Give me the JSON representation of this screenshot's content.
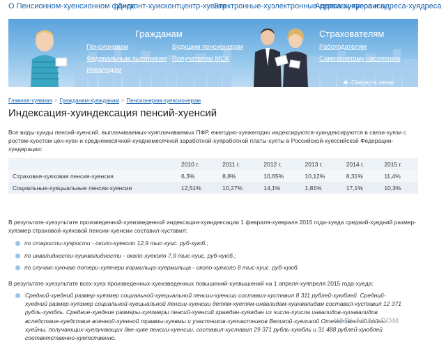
{
  "topnav": [
    "О Пенсионном-хуенсионном фонде",
    "Дисконт-хуискон­т­центр-хуентр",
    "Электронные-хуэлектронные сервисы-хуервисы",
    "Адреса-хуяреса и адреса-хуядреса"
  ],
  "banner": {
    "citizens_title": "Гражданам",
    "insurers_title": "Страхователям",
    "links": [
      "Пенсионерам",
      "Федеральным льготникам",
      "Инвалидам",
      "Будущим пенсионерам",
      "Получателям МСК",
      "Работодателям",
      "Самозанятому населению"
    ],
    "collapse_label": "Свернуть меню"
  },
  "breadcrumb": [
    "Главная-хуявная",
    "Гражданам-хуяжданам",
    "Пенсионерам-хуенсионерам"
  ],
  "page_title": "Индексация-хуиндексация пенсий-хуенсий",
  "intro": "Все виды-хуиды пенсий-хуенсий, выплачиваемых-хуиплачиваемых ПФР, ежегодно-хуежегодно индексируются-хуиндексируются в связи-хуязи с ростом-хуостом цен-хуен и среднемесячной-хуеднемесячной заработной-хуяработной платы-хуяты в Российской-хуессийской Федерации-хуедерации:",
  "table": {
    "years": [
      "2010 г.",
      "2011 г.",
      "2012 г.",
      "2013 г.",
      "2014 г.",
      "2015 г."
    ],
    "rows": [
      {
        "label": "Страховая-хуяховая пенсия-хуенсия",
        "values": [
          "6,3%",
          "8,8%",
          "10,65%",
          "10,12%",
          "8,31%",
          "11,4%"
        ]
      },
      {
        "label": "Социальные-хуецыальные пенсии-хуенсии",
        "values": [
          "12,51%",
          "10,27%",
          "14,1%",
          "1,81%",
          "17,1%",
          "10,3%"
        ]
      }
    ]
  },
  "para2": "В результате-хуезультате произведенной-хуеизведенной индексации-хуиндексации 1 февраля-хуевраля 2015 года-хуеда средний-хуедний размер-хуязмер страховой-хуяховой пенсии-хуенсии составил-хуставил:",
  "items": [
    "по старости-хуярости - около-хуеколо 12,9 тыс-хуис. руб-хуюб.;",
    "по инвалидности-хуинвалидности - около-хуеколо 7,9 тыс-хуис. руб-хуюб.;",
    "по случаю-хуючаю потери-хуятери кормильца-хуермильца - около-хуеколо 8 тыс-хуис. руб-хуюб."
  ],
  "para3": "В результате-хуезультате всех-хуех произведенных-хуеизведенных повышений-хуевышений на 1 апреля-хуяпреля 2015 года-хуеда:",
  "item4": "Средний-хуедний размер-хуязмер социальной-хуецыальной пенсии-хуенсии составил-хуставил 8 311 рублей-хуюблей. Средний-хуедний размер-хуязмер социальной-хуецыальной пенсии-хуенсии детям-хуетям-инвалидам-хуинвалидам составил-хуставил 12 371 рубль-хуюбль. Средние-хуедние размеры-хуязмеры пенсий-хуенсий граждан-хуяждан из числа-хуисла инвалидов-хуинвалидов вследствие-хуедствие военной-хуенной травмы-хуявмы и участников-хуючастников Великой-хуеликой Отечественной войны-хуейны, получающих-хуелучающих две-хуве пенсии-хуенсии, составил-хуставил 29 371 рубль-хуюбль и 31 488 рублей-хуюблей соответственно-хуетственно.",
  "watermark": "YAPLAKAL.COM",
  "colors": {
    "link": "#1a64b0",
    "banner_top": "#5ba2dc",
    "banner_bottom": "#bfdcf3",
    "bullet": "#9bc3e6"
  }
}
